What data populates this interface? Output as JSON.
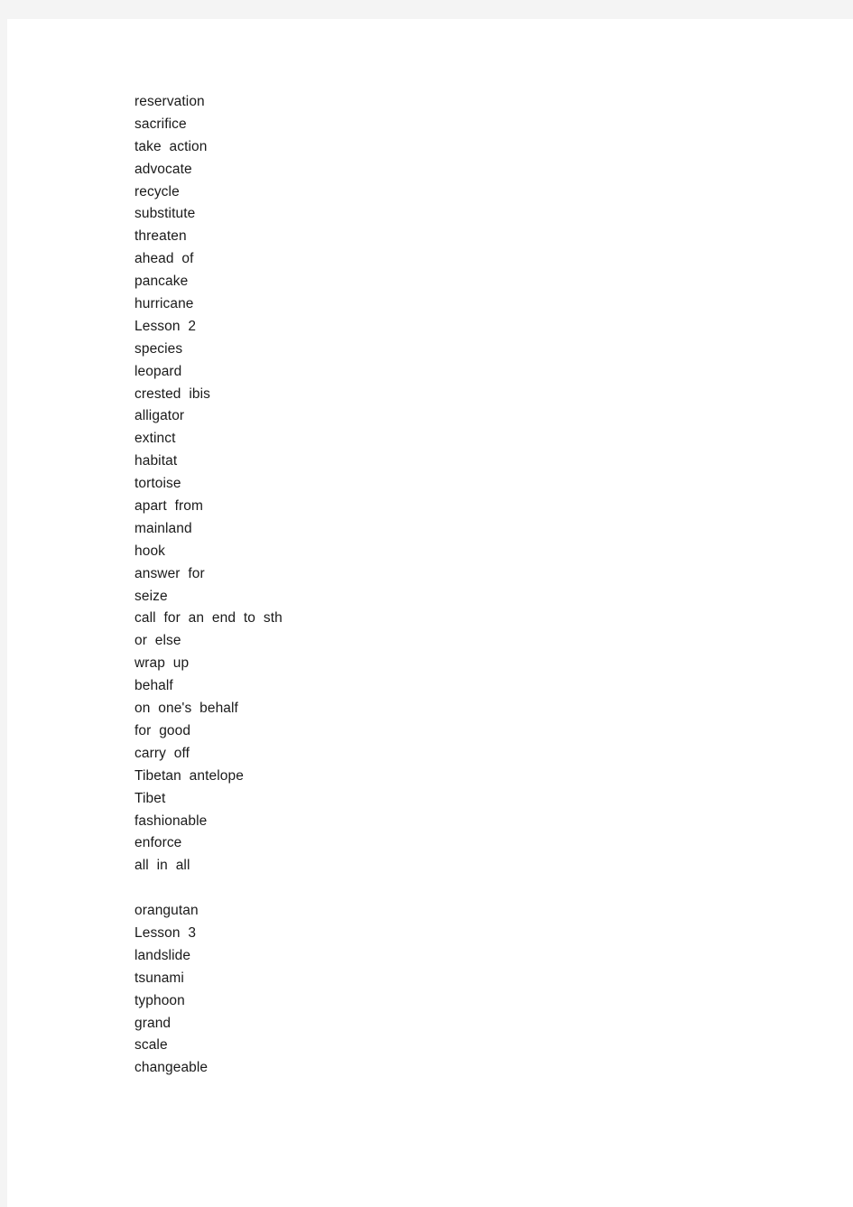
{
  "page": {
    "background_color": "#f4f4f4",
    "paper_color": "#ffffff",
    "text_color": "#1a1a1a"
  },
  "word_list": {
    "entries": [
      {
        "text": "reservation",
        "type": "word"
      },
      {
        "text": "sacrifice",
        "type": "word"
      },
      {
        "text": "take  action",
        "type": "phrase"
      },
      {
        "text": "advocate",
        "type": "word"
      },
      {
        "text": "recycle",
        "type": "word"
      },
      {
        "text": "substitute",
        "type": "word"
      },
      {
        "text": "threaten",
        "type": "word"
      },
      {
        "text": "ahead  of",
        "type": "phrase"
      },
      {
        "text": "pancake",
        "type": "word"
      },
      {
        "text": "hurricane",
        "type": "word"
      },
      {
        "text": "Lesson  2",
        "type": "heading"
      },
      {
        "text": "species",
        "type": "word"
      },
      {
        "text": "leopard",
        "type": "word"
      },
      {
        "text": "crested  ibis",
        "type": "phrase"
      },
      {
        "text": "alligator",
        "type": "word"
      },
      {
        "text": "extinct",
        "type": "word"
      },
      {
        "text": "habitat",
        "type": "word"
      },
      {
        "text": "tortoise",
        "type": "word"
      },
      {
        "text": "apart  from",
        "type": "phrase"
      },
      {
        "text": "mainland",
        "type": "word"
      },
      {
        "text": "hook",
        "type": "word"
      },
      {
        "text": "answer  for",
        "type": "phrase"
      },
      {
        "text": "seize",
        "type": "word"
      },
      {
        "text": "call  for  an  end  to  sth",
        "type": "phrase"
      },
      {
        "text": "or  else",
        "type": "phrase"
      },
      {
        "text": "wrap  up",
        "type": "phrase"
      },
      {
        "text": "behalf",
        "type": "word"
      },
      {
        "text": "on  one's  behalf",
        "type": "phrase"
      },
      {
        "text": "for  good",
        "type": "phrase"
      },
      {
        "text": "carry  off",
        "type": "phrase"
      },
      {
        "text": "Tibetan  antelope",
        "type": "phrase"
      },
      {
        "text": "Tibet",
        "type": "word"
      },
      {
        "text": "fashionable",
        "type": "word"
      },
      {
        "text": "enforce",
        "type": "word"
      },
      {
        "text": "all  in  all",
        "type": "phrase"
      },
      {
        "text": "",
        "type": "blank"
      },
      {
        "text": "orangutan",
        "type": "word"
      },
      {
        "text": "Lesson  3",
        "type": "heading"
      },
      {
        "text": "landslide",
        "type": "word"
      },
      {
        "text": "tsunami",
        "type": "word"
      },
      {
        "text": "typhoon",
        "type": "word"
      },
      {
        "text": "grand",
        "type": "word"
      },
      {
        "text": "scale",
        "type": "word"
      },
      {
        "text": "changeable",
        "type": "word"
      }
    ]
  }
}
